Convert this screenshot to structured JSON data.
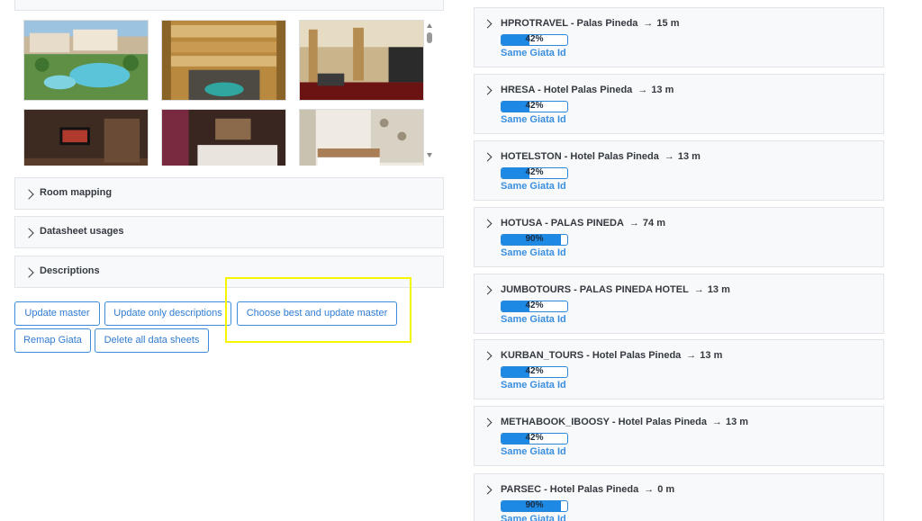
{
  "gallery": {
    "images": [
      {
        "name": "hotel-aerial-pool-image"
      },
      {
        "name": "hotel-atrium-image"
      },
      {
        "name": "hotel-lobby-image"
      },
      {
        "name": "hotel-room-tv-image"
      },
      {
        "name": "hotel-room-bed-image"
      },
      {
        "name": "hotel-room-twin-image"
      }
    ]
  },
  "sections": [
    {
      "label": "Room mapping"
    },
    {
      "label": "Datasheet usages"
    },
    {
      "label": "Descriptions"
    }
  ],
  "buttons": {
    "update_master": "Update master",
    "update_only_descriptions": "Update only descriptions",
    "choose_best": "Choose best and update master",
    "remap_giata": "Remap Giata",
    "delete_all": "Delete all data sheets"
  },
  "matches": [
    {
      "title": "HPROTRAVEL - Palas Pineda",
      "distance": "15 m",
      "score": "42%",
      "score_value": 0.42,
      "note": "Same Giata Id"
    },
    {
      "title": "HRESA - Hotel Palas Pineda",
      "distance": "13 m",
      "score": "42%",
      "score_value": 0.42,
      "note": "Same Giata Id"
    },
    {
      "title": "HOTELSTON - Hotel Palas Pineda",
      "distance": "13 m",
      "score": "42%",
      "score_value": 0.42,
      "note": "Same Giata Id"
    },
    {
      "title": "HOTUSA - PALAS PINEDA",
      "distance": "74 m",
      "score": "90%",
      "score_value": 0.9,
      "note": "Same Giata Id"
    },
    {
      "title": "JUMBOTOURS - PALAS PINEDA HOTEL",
      "distance": "13 m",
      "score": "42%",
      "score_value": 0.42,
      "note": "Same Giata Id"
    },
    {
      "title": "KURBAN_TOURS - Hotel Palas Pineda",
      "distance": "13 m",
      "score": "42%",
      "score_value": 0.42,
      "note": "Same Giata Id"
    },
    {
      "title": "METHABOOK_IBOOSY - Hotel Palas Pineda",
      "distance": "13 m",
      "score": "42%",
      "score_value": 0.42,
      "note": "Same Giata Id"
    },
    {
      "title": "PARSEC - Hotel Palas Pineda",
      "distance": "0 m",
      "score": "90%",
      "score_value": 0.9,
      "note": "Same Giata Id"
    }
  ],
  "colors": {
    "accent": "#2f7bd0",
    "progress": "#1e88e5",
    "highlight": "#f5f500"
  }
}
